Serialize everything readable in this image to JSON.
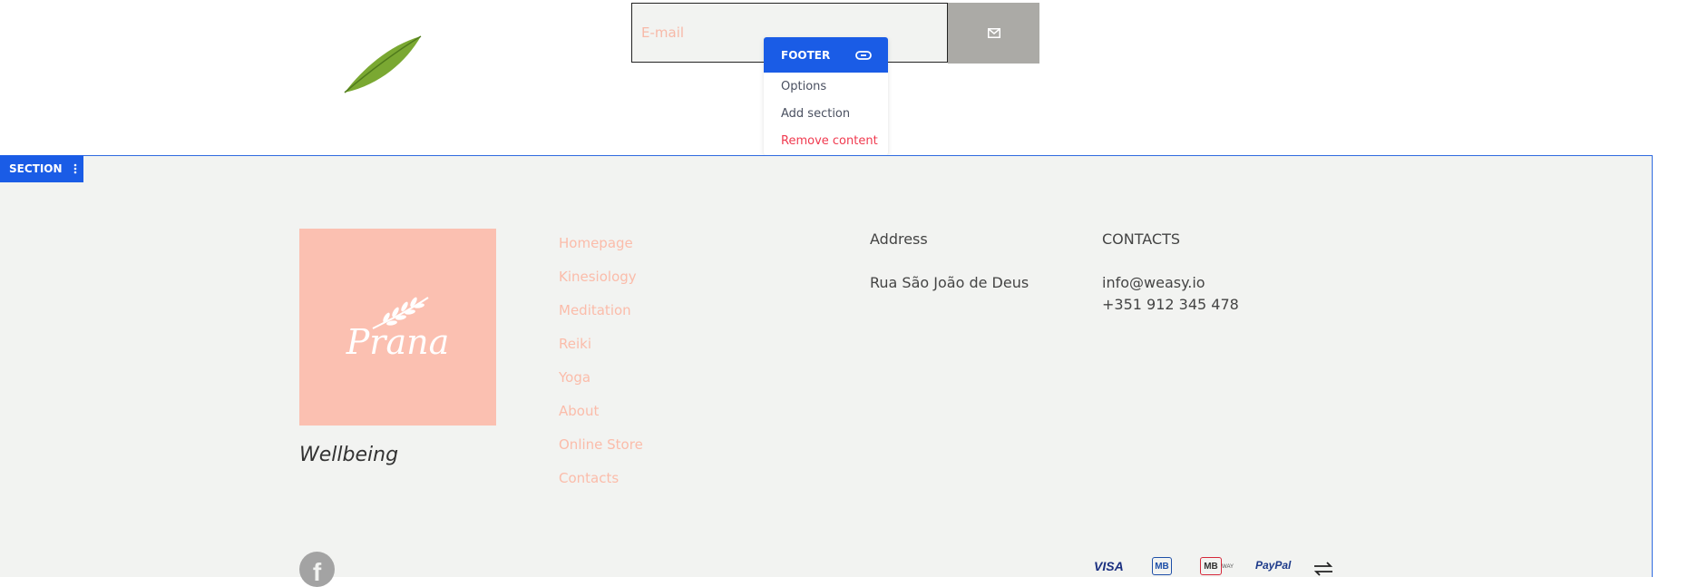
{
  "newsletter": {
    "email_placeholder": "E-mail"
  },
  "context_menu": {
    "title": "FOOTER",
    "items": [
      {
        "label": "Options"
      },
      {
        "label": "Add section"
      },
      {
        "label": "Remove content"
      }
    ]
  },
  "section_badge": {
    "label": "SECTION"
  },
  "footer": {
    "logo_text": "Prana",
    "tagline": "Wellbeing",
    "nav": [
      {
        "label": "Homepage"
      },
      {
        "label": "Kinesiology"
      },
      {
        "label": "Meditation"
      },
      {
        "label": "Reiki"
      },
      {
        "label": "Yoga"
      },
      {
        "label": "About"
      },
      {
        "label": "Online Store"
      },
      {
        "label": "Contacts"
      }
    ],
    "address": {
      "title": "Address",
      "line": "Rua São João de Deus"
    },
    "contacts": {
      "title": "CONTACTS",
      "email": "info@weasy.io",
      "phone": "+351 912 345 478"
    },
    "payments": {
      "visa": "VISA",
      "mb": "MB",
      "mbway": "MB",
      "mbway_small": "WAY",
      "paypal": "PayPal"
    }
  },
  "colors": {
    "accent_blue": "#1a5ce6",
    "salmon": "#fbc0b1",
    "footer_bg": "#f2f3f1",
    "danger": "#f03a4f"
  }
}
